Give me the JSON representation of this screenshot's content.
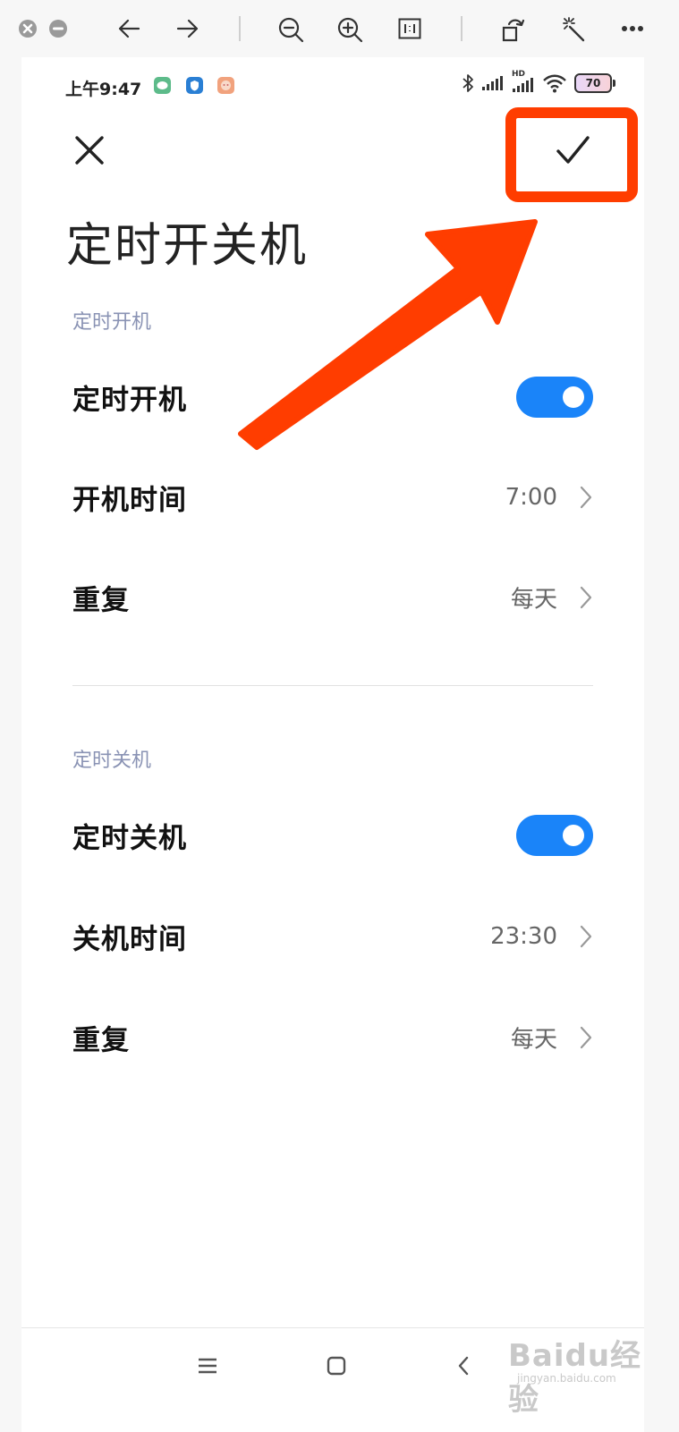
{
  "viewer_toolbar": {
    "icons": [
      "close-circle-icon",
      "minus-circle-icon",
      "arrow-left-icon",
      "arrow-right-icon",
      "zoom-out-icon",
      "zoom-in-icon",
      "actual-size-icon",
      "rotate-icon",
      "magic-wand-icon",
      "more-icon"
    ]
  },
  "status_bar": {
    "time": "上午9:47",
    "app_icons": [
      "wechat-icon",
      "shield-app-icon",
      "avatar-app-icon"
    ],
    "hd_label": "HD",
    "battery": "70"
  },
  "header": {
    "close_icon": "close-icon",
    "confirm_icon": "check-icon",
    "highlight_color": "#ff3d00"
  },
  "page": {
    "title": "定时开关机"
  },
  "power_on": {
    "section_label": "定时开机",
    "toggle_label": "定时开机",
    "toggle_on": true,
    "time_label": "开机时间",
    "time_value": "7:00",
    "repeat_label": "重复",
    "repeat_value": "每天"
  },
  "power_off": {
    "section_label": "定时关机",
    "toggle_label": "定时关机",
    "toggle_on": true,
    "time_label": "关机时间",
    "time_value": "23:30",
    "repeat_label": "重复",
    "repeat_value": "每天"
  },
  "nav_bar": {
    "icons": [
      "menu-icon",
      "home-icon",
      "back-icon"
    ]
  },
  "colors": {
    "accent": "#1a84f9",
    "annotation": "#ff3d00",
    "section": "#8a93b4"
  },
  "watermark": {
    "text": "Baidu经验",
    "sub": "jingyan.baidu.com"
  }
}
